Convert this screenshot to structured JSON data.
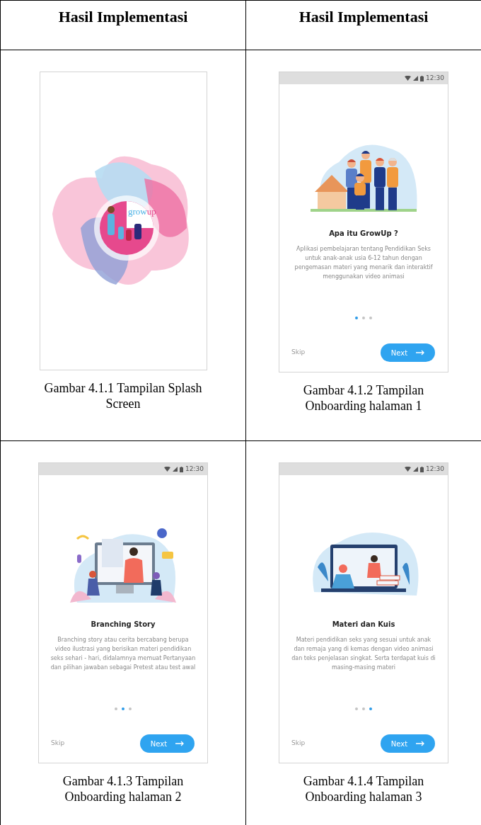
{
  "table": {
    "columns": [
      "Hasil Implementasi",
      "Hasil Implementasi"
    ],
    "rows": [
      {
        "cells": [
          {
            "kind": "splash",
            "logo": [
              "grow",
              "up"
            ],
            "caption": "Gambar 4.1.1 Tampilan Splash Screen"
          },
          {
            "kind": "onboarding",
            "status_time": "12:30",
            "title": "Apa itu GrowUp ?",
            "description": "Aplikasi pembelajaran tentang Pendidikan Seks untuk anak-anak usia 6-12 tahun dengan pengemasan materi yang menarik dan interaktif menggunakan video animasi",
            "pages": [
              {
                "selected": true
              },
              {
                "selected": false
              },
              {
                "selected": false
              }
            ],
            "skip": "Skip",
            "next": "Next",
            "caption": "Gambar 4.1.2 Tampilan Onboarding halaman 1"
          }
        ]
      },
      {
        "cells": [
          {
            "kind": "onboarding",
            "status_time": "12:30",
            "title": "Branching Story",
            "description": "Branching story atau cerita bercabang berupa video ilustrasi yang berisikan materi pendidikan seks sehari - hari, didalamnya memuat Pertanyaan dan pilihan jawaban sebagai Pretest atau test awal",
            "pages": [
              {
                "selected": false
              },
              {
                "selected": true
              },
              {
                "selected": false
              }
            ],
            "skip": "Skip",
            "next": "Next",
            "caption": "Gambar 4.1.3 Tampilan Onboarding halaman 2"
          },
          {
            "kind": "onboarding",
            "status_time": "12:30",
            "title": "Materi dan Kuis",
            "description": "Materi pendidikan seks yang sesuai untuk anak dan remaja yang di kemas dengan video animasi dan teks penjelasan singkat. Serta terdapat kuis di masing-masing materi",
            "pages": [
              {
                "selected": false
              },
              {
                "selected": false
              },
              {
                "selected": true
              }
            ],
            "skip": "Skip",
            "next": "Next",
            "caption": "Gambar 4.1.4 Tampilan Onboarding halaman 3"
          }
        ]
      }
    ]
  }
}
